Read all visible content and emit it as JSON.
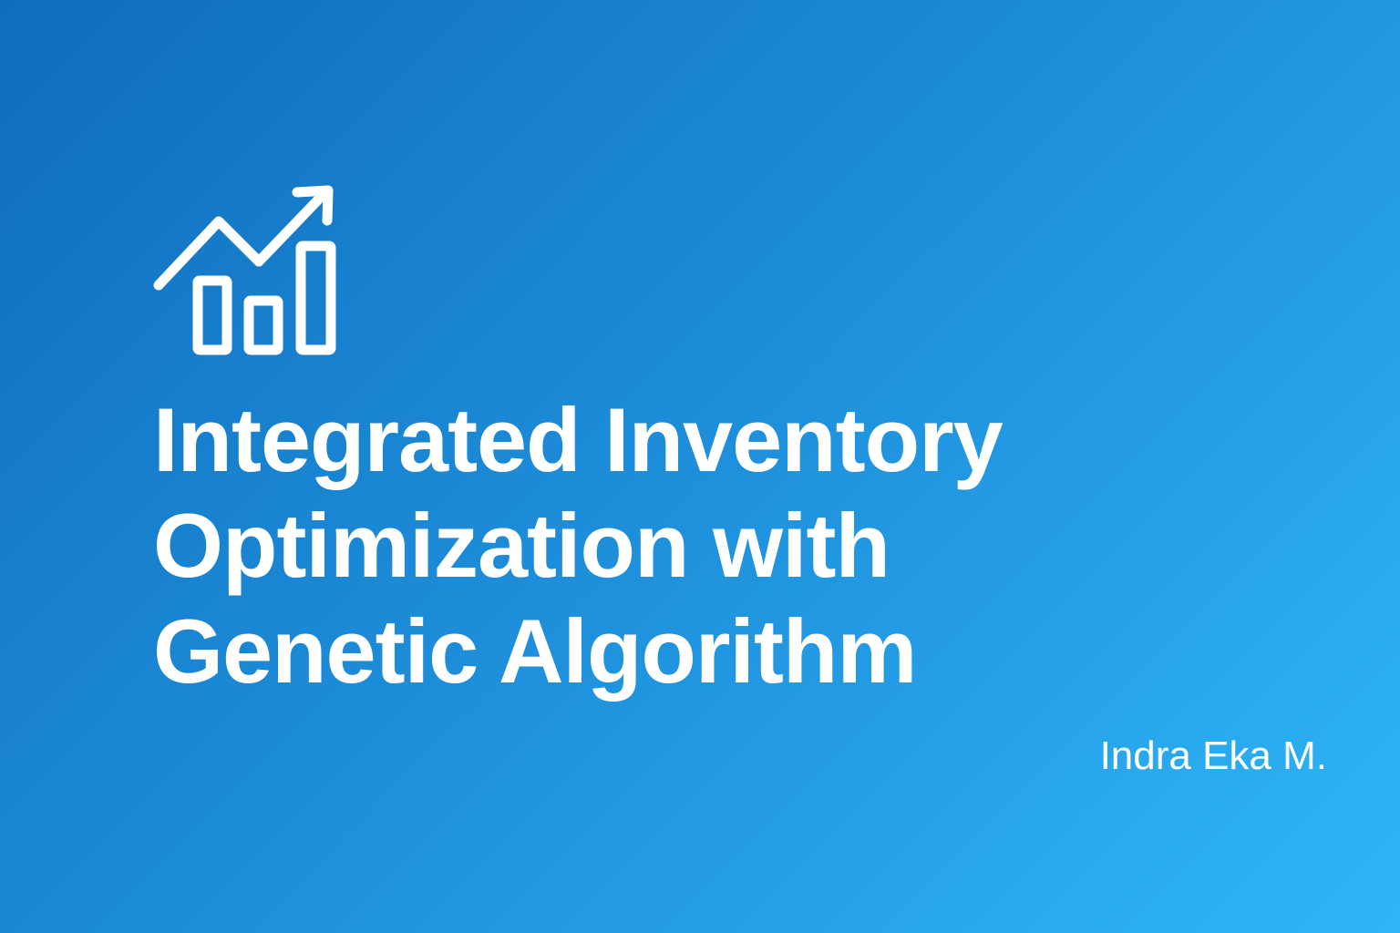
{
  "slide": {
    "title_lines": [
      "Integrated Inventory",
      "Optimization with",
      "Genetic Algorithm"
    ],
    "author": "Indra Eka M."
  },
  "icons": {
    "header_icon": "trending-bar-chart-icon"
  },
  "colors": {
    "background_start": "#0f6dbd",
    "background_end": "#2fb6f8",
    "text": "#ffffff"
  }
}
